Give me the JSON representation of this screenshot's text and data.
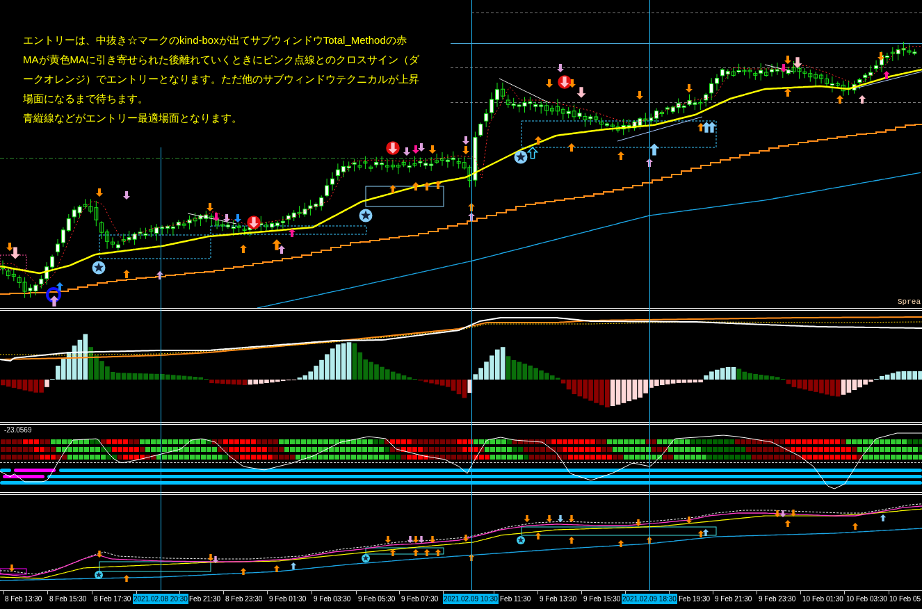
{
  "annotation": {
    "paragraphs": [
      {
        "lines": [
          "エントリーは、中抜き☆マークのkind-boxが出てサブウィンドウTotal_Methodの赤",
          "MAが黄色MAに引き寄せられた後離れていくときにピンク点線とのクロスサイン（ダ",
          "ークオレンジ）でエントリーとなります。ただ他のサブウィンドウテクニカルが上昇",
          "場面になるまで待ちます。"
        ]
      },
      {
        "lines": [
          "青縦線などがエントリー最適場面となります。"
        ]
      }
    ]
  },
  "main_chart": {
    "corner_label": "Sprea"
  },
  "oscillator_window": {
    "value_label": "-23.0569"
  },
  "time_axis": {
    "labels": [
      {
        "text": "8 Feb 13:30",
        "highlighted": false
      },
      {
        "text": "8 Feb 15:30",
        "highlighted": false
      },
      {
        "text": "8 Feb 17:30",
        "highlighted": false
      },
      {
        "text": "2021.02.08 20:30",
        "highlighted": true
      },
      {
        "text": "Feb 21:30",
        "highlighted": false
      },
      {
        "text": "8 Feb 23:30",
        "highlighted": false
      },
      {
        "text": "9 Feb 01:30",
        "highlighted": false
      },
      {
        "text": "9 Feb 03:30",
        "highlighted": false
      },
      {
        "text": "9 Feb 05:30",
        "highlighted": false
      },
      {
        "text": "9 Feb 07:30",
        "highlighted": false
      },
      {
        "text": "2021.02.09 10:30",
        "highlighted": true
      },
      {
        "text": "Feb 11:30",
        "highlighted": false
      },
      {
        "text": "9 Feb 13:30",
        "highlighted": false
      },
      {
        "text": "9 Feb 15:30",
        "highlighted": false
      },
      {
        "text": "2021.02.09 18:30",
        "highlighted": true
      },
      {
        "text": "Feb 19:30",
        "highlighted": false
      },
      {
        "text": "9 Feb 21:30",
        "highlighted": false
      },
      {
        "text": "9 Feb 23:30",
        "highlighted": false
      },
      {
        "text": "10 Feb 01:30",
        "highlighted": false
      },
      {
        "text": "10 Feb 03:30",
        "highlighted": false
      },
      {
        "text": "10 Feb 05",
        "highlighted": false
      }
    ]
  }
}
